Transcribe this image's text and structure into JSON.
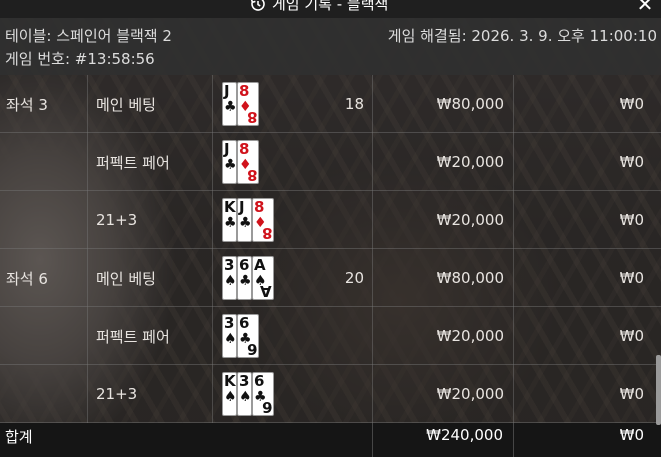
{
  "title": "게임 기록 - 블랙잭",
  "info": {
    "table_name": "테이블: 스페인어 블랙잭 2",
    "resolved": "게임 해결됨: 2026. 3. 9. 오후 11:00:10",
    "game_no": "게임 번호: #13:58:56"
  },
  "rows": [
    {
      "seat": "좌석 3",
      "bet": "메인 베팅",
      "score": "18",
      "amount": "₩80,000",
      "win": "₩0",
      "cards": [
        {
          "rank": "J",
          "suit": "♣",
          "color": "black"
        },
        {
          "rank": "8",
          "suit": "♦",
          "color": "red"
        }
      ]
    },
    {
      "seat": "",
      "bet": "퍼펙트 페어",
      "score": "",
      "amount": "₩20,000",
      "win": "₩0",
      "cards": [
        {
          "rank": "J",
          "suit": "♣",
          "color": "black"
        },
        {
          "rank": "8",
          "suit": "♦",
          "color": "red"
        }
      ]
    },
    {
      "seat": "",
      "bet": "21+3",
      "score": "",
      "amount": "₩20,000",
      "win": "₩0",
      "cards": [
        {
          "rank": "K",
          "suit": "♣",
          "color": "black"
        },
        {
          "rank": "J",
          "suit": "♣",
          "color": "black"
        },
        {
          "rank": "8",
          "suit": "♦",
          "color": "red"
        }
      ]
    },
    {
      "seat": "좌석 6",
      "bet": "메인 베팅",
      "score": "20",
      "amount": "₩80,000",
      "win": "₩0",
      "cards": [
        {
          "rank": "3",
          "suit": "♠",
          "color": "black"
        },
        {
          "rank": "6",
          "suit": "♣",
          "color": "black"
        },
        {
          "rank": "A",
          "suit": "♠",
          "color": "black"
        }
      ]
    },
    {
      "seat": "",
      "bet": "퍼펙트 페어",
      "score": "",
      "amount": "₩20,000",
      "win": "₩0",
      "cards": [
        {
          "rank": "3",
          "suit": "♠",
          "color": "black"
        },
        {
          "rank": "6",
          "suit": "♣",
          "color": "black"
        }
      ]
    },
    {
      "seat": "",
      "bet": "21+3",
      "score": "",
      "amount": "₩20,000",
      "win": "₩0",
      "cards": [
        {
          "rank": "K",
          "suit": "♠",
          "color": "black"
        },
        {
          "rank": "3",
          "suit": "♠",
          "color": "black"
        },
        {
          "rank": "6",
          "suit": "♣",
          "color": "black"
        }
      ]
    }
  ],
  "total": {
    "label": "합계",
    "amount": "₩240,000",
    "win": "₩0"
  },
  "icons": {
    "history": "history-icon",
    "close": "close-icon"
  }
}
